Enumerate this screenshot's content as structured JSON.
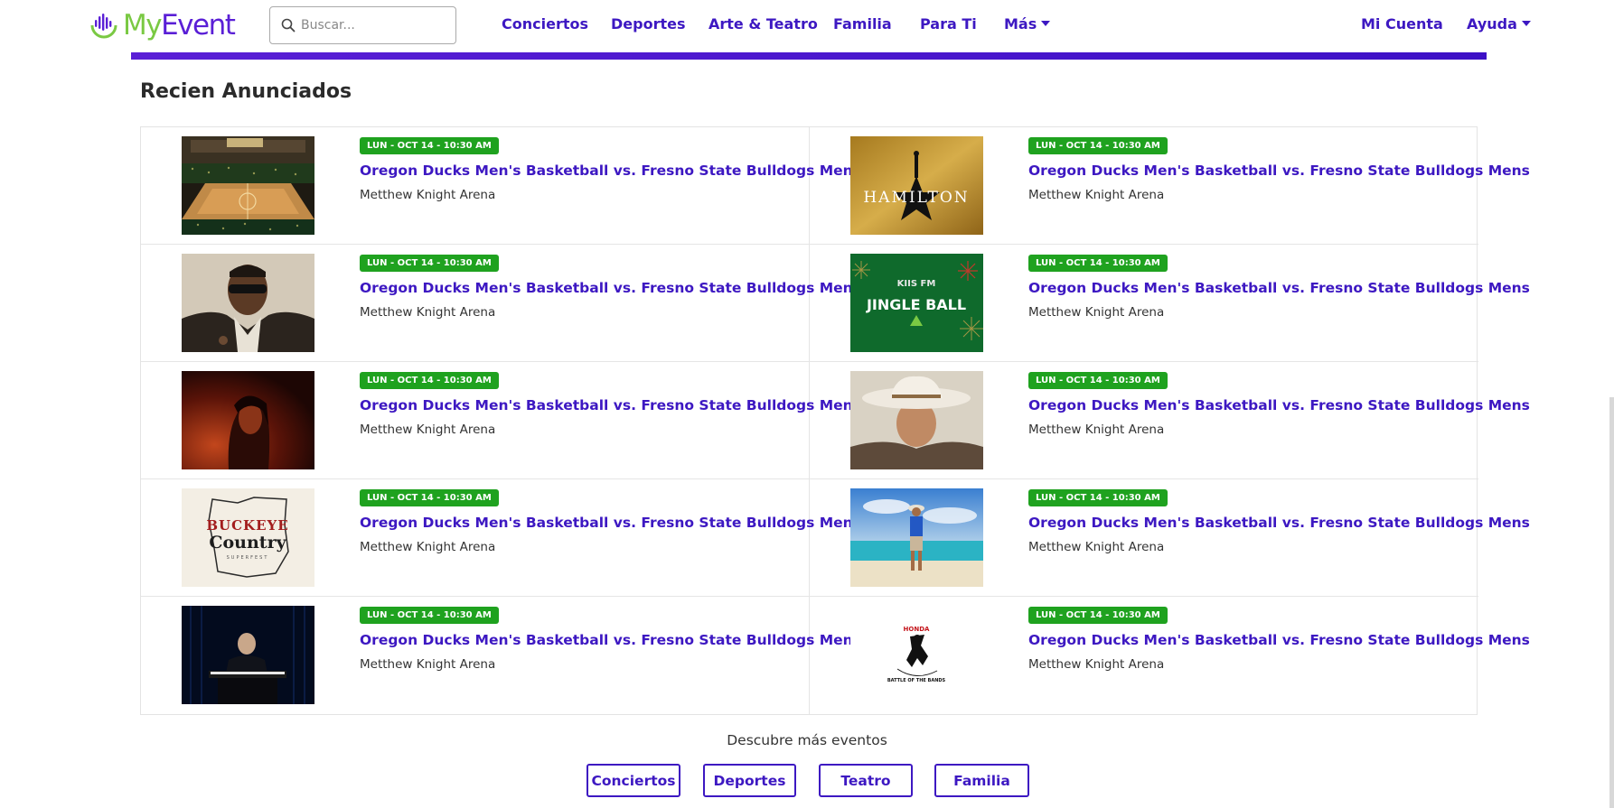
{
  "brand": {
    "logo_part1": "My",
    "logo_part2": "Event"
  },
  "search": {
    "placeholder": "Buscar..."
  },
  "nav": {
    "items": [
      {
        "label": "Conciertos"
      },
      {
        "label": "Deportes"
      },
      {
        "label": "Arte & Teatro"
      },
      {
        "label": "Familia"
      },
      {
        "label": "Para Ti"
      },
      {
        "label": "Más"
      }
    ],
    "right": [
      {
        "label": "Mi Cuenta"
      },
      {
        "label": "Ayuda"
      }
    ]
  },
  "section": {
    "title": "Recien Anunciados"
  },
  "events": [
    {
      "date": "LUN - OCT 14 - 10:30 AM",
      "title": "Oregon Ducks Men's Basketball vs. Fresno State Bulldogs Mens",
      "venue": "Metthew Knight Arena"
    },
    {
      "date": "LUN - OCT 14 - 10:30 AM",
      "title": "Oregon Ducks Men's Basketball vs. Fresno State Bulldogs Mens",
      "venue": "Metthew Knight Arena",
      "image_text": "HAMILTON"
    },
    {
      "date": "LUN - OCT 14 - 10:30 AM",
      "title": "Oregon Ducks Men's Basketball vs. Fresno State Bulldogs Mens",
      "venue": "Metthew Knight Arena"
    },
    {
      "date": "LUN - OCT 14 - 10:30 AM",
      "title": "Oregon Ducks Men's Basketball vs. Fresno State Bulldogs Mens",
      "venue": "Metthew Knight Arena",
      "image_text": "JINGLE BALL"
    },
    {
      "date": "LUN - OCT 14 - 10:30 AM",
      "title": "Oregon Ducks Men's Basketball vs. Fresno State Bulldogs Mens",
      "venue": "Metthew Knight Arena"
    },
    {
      "date": "LUN - OCT 14 - 10:30 AM",
      "title": "Oregon Ducks Men's Basketball vs. Fresno State Bulldogs Mens",
      "venue": "Metthew Knight Arena"
    },
    {
      "date": "LUN - OCT 14 - 10:30 AM",
      "title": "Oregon Ducks Men's Basketball vs. Fresno State Bulldogs Mens",
      "venue": "Metthew Knight Arena",
      "image_text": "BUCKEYE Country"
    },
    {
      "date": "LUN - OCT 14 - 10:30 AM",
      "title": "Oregon Ducks Men's Basketball vs. Fresno State Bulldogs Mens",
      "venue": "Metthew Knight Arena"
    },
    {
      "date": "LUN - OCT 14 - 10:30 AM",
      "title": "Oregon Ducks Men's Basketball vs. Fresno State Bulldogs Mens",
      "venue": "Metthew Knight Arena"
    },
    {
      "date": "LUN - OCT 14 - 10:30 AM",
      "title": "Oregon Ducks Men's Basketball vs. Fresno State Bulldogs Mens",
      "venue": "Metthew Knight Arena",
      "image_text": "HONDA BATTLE OF THE BANDS"
    }
  ],
  "discover": {
    "label": "Descubre más eventos",
    "buttons": [
      {
        "label": "Conciertos"
      },
      {
        "label": "Deportes"
      },
      {
        "label": "Teatro"
      },
      {
        "label": "Familia"
      }
    ]
  },
  "colors": {
    "accent": "#3d18c2",
    "badge": "#1fa21f",
    "logo_green": "#7ac943",
    "logo_purple": "#5a1fd6"
  }
}
